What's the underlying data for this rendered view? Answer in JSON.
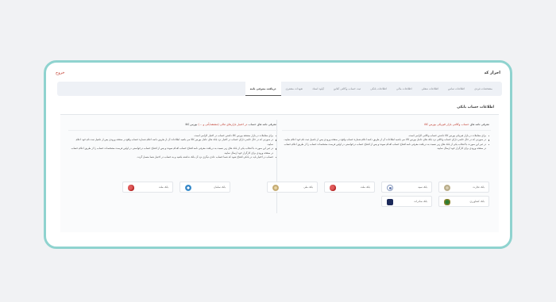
{
  "header": {
    "code_title": "احراز کد",
    "exit_label": "خروج"
  },
  "tabs": [
    "مشخصات فردی",
    "اطلاعات تماس",
    "اطلاعات شغلی",
    "اطلاعات مالی",
    "اطلاعات بانکی",
    "ثبت حساب وکالتی آنلاین",
    "آپلود اسناد",
    "تعهدات مشتری",
    "دریافت معرفی نامه"
  ],
  "active_tab_index": 8,
  "section": {
    "title": "اطلاعات حساب بانکی"
  },
  "right_column": {
    "title_prefix": "معرفی نامه های ",
    "title_highlight": "حساب وکالتی بازار فیزیکی بورس کالا",
    "bullets": [
      "برای معاملات در بازار فیزیکی بورس کالا داشتن حساب وکالتی الزامی است.",
      "در صورتی که در حال حاضر دارای حساب وکالتی نزد بانک های عامل بورس کالا می باشید اطلاعات آن از طریق دکمه اعلام شماره حساب واقع در صفحه ورودی پس از تکمیل ثبت نام خود اعلام نمایید.",
      "در غیر این صورت با انتخاب یکی از بانک های زیر نسبت به دریافت معرفی نامه افتتاح حساب اقدام نموده و پس از افتتاح حساب درخواستی در اولین فرصت مشخصات حساب را از طریق اعلام حساب در صفحه ورودی برای کارگزار خود ارسال نمایید."
    ],
    "banks": [
      {
        "name": "بانک تجارت",
        "icon": "tejarat-logo"
      },
      {
        "name": "بانک سپه",
        "icon": "sepah-logo"
      },
      {
        "name": "بانک ملت",
        "icon": "mellat-logo"
      },
      {
        "name": "بانک ملی",
        "icon": "melli-logo"
      },
      {
        "name": "بانک کشاورزی",
        "icon": "keshavarzi-logo"
      },
      {
        "name": "بانک صادرات",
        "icon": "saderat-logo"
      }
    ]
  },
  "left_column": {
    "title_prefix": "معرفی نامه های حساب ",
    "title_highlight": "در اختیار بازارهای مالی (مشتقه/آتی و ...)",
    "title_suffix": " بورس کالا",
    "bullets": [
      "برای معاملات در بازار مشتقه بورس کالا داشتن حساب در اختیار الزامی است.",
      "در صورتی که در حال حاضر دارای حساب در اختیار نزد بانک های عامل بورس کالا می باشید اطلاعات آن از طریق دکمه اعلام شماره حساب واقع در صفحه ورودی پس از تکمیل ثبت نام خود اعلام نمایید.",
      "در غیر این صورت با انتخاب یکی از بانک های زیر نسبت به دریافت معرفی نامه افتتاح حساب اقدام نموده و پس از افتتاح حساب درخواستی در اولین فرصت مشخصات حساب را از طریق اعلام حساب در صفحه ورودی برای کارگزار خود ارسال نمایید.",
      "حساب در اختیار باید در بانکی افتتاح شود که شما حساب عادی دیگری نزد آن بانک نداشته باشید و به حساب در اختیار شما متصل گردد."
    ],
    "banks": [
      {
        "name": "بانک سامان",
        "icon": "saman-logo"
      },
      {
        "name": "بانک ملت",
        "icon": "mellat-logo"
      }
    ]
  },
  "colors": {
    "frame_border": "#8fd3cf",
    "highlight": "#c0392b",
    "tabs_bg": "#eef1f6"
  }
}
